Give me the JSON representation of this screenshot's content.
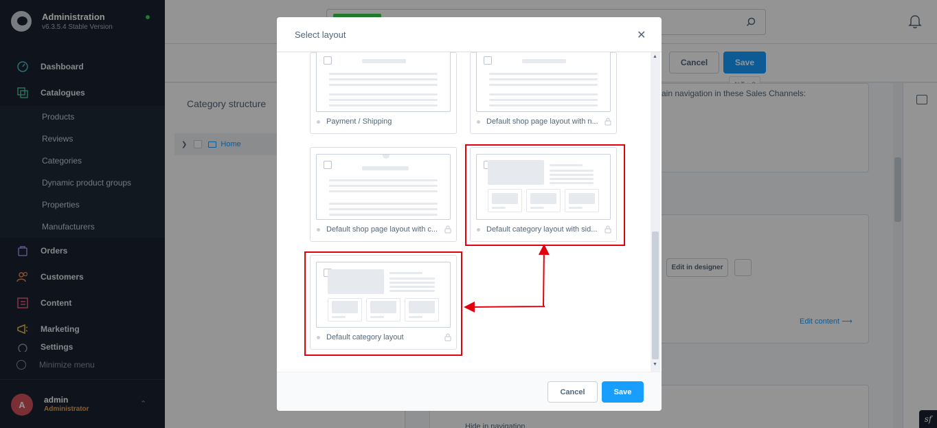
{
  "sidebar": {
    "brand_title": "Administration",
    "brand_version": "v6.3.5.4 Stable Version",
    "nav": {
      "dashboard": "Dashboard",
      "catalogues": "Catalogues",
      "orders": "Orders",
      "customers": "Customers",
      "content": "Content",
      "marketing": "Marketing",
      "settings": "Settings"
    },
    "catalogue_items": [
      "Products",
      "Reviews",
      "Categories",
      "Dynamic product groups",
      "Properties",
      "Manufacturers"
    ],
    "minimize": "Minimize menu",
    "user": {
      "initial": "A",
      "name": "admin",
      "role": "Administrator"
    }
  },
  "background": {
    "cancel": "Cancel",
    "save": "Save",
    "save_shortcut": "ALT + S",
    "category_structure": "Category structure",
    "tree_home": "Home",
    "main_nav_text": "ain navigation in these Sales Channels:",
    "edit_in_designer": "Edit in designer",
    "edit_content": "Edit content",
    "hide_in_navigation": "Hide in navigation"
  },
  "modal": {
    "title": "Select layout",
    "cancel": "Cancel",
    "save": "Save",
    "layouts": [
      {
        "label": "Payment / Shipping",
        "locked": false
      },
      {
        "label": "Default shop page layout with n...",
        "locked": true
      },
      {
        "label": "Default shop page layout with c...",
        "locked": true
      },
      {
        "label": "Default category layout with sid...",
        "locked": true
      },
      {
        "label": "Default category layout",
        "locked": true
      }
    ]
  },
  "colors": {
    "accent": "#189eff",
    "sidebar_bg": "#1b2431",
    "highlight": "#e2000f",
    "role": "#f2a045",
    "status": "#37d046"
  }
}
